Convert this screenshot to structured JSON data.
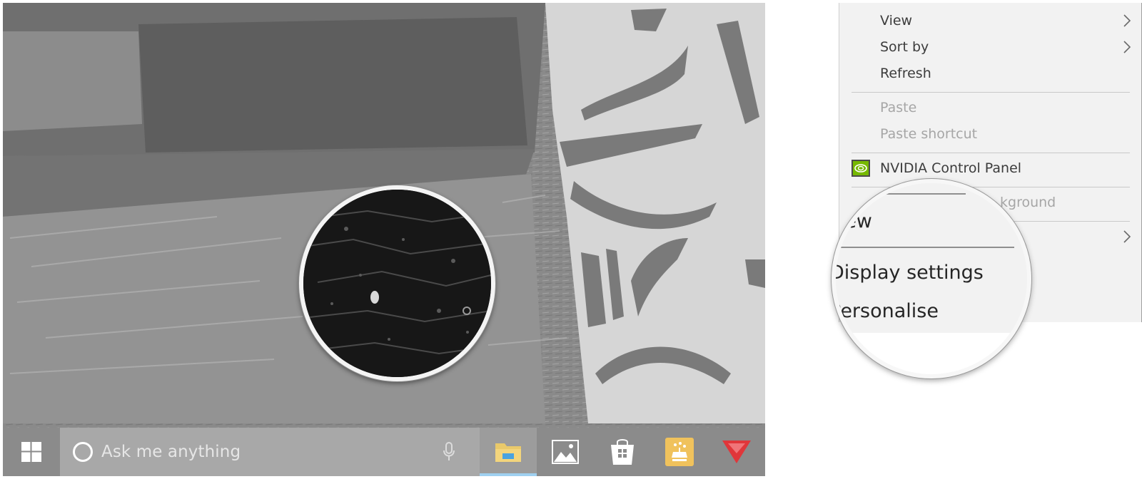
{
  "taskbar": {
    "search_placeholder": "Ask me anything",
    "icons": [
      "windows-start-icon",
      "cortana-icon",
      "microphone-icon",
      "file-explorer-icon",
      "photos-icon",
      "store-icon",
      "paint-icon",
      "app-red-icon"
    ],
    "active_indicator_color": "#9fd0f0"
  },
  "context_menu": {
    "items": [
      {
        "label": "View",
        "enabled": true,
        "submenu": true
      },
      {
        "label": "Sort by",
        "enabled": true,
        "submenu": true
      },
      {
        "label": "Refresh",
        "enabled": true,
        "submenu": false
      },
      {
        "label": "Paste",
        "enabled": false,
        "submenu": false
      },
      {
        "label": "Paste shortcut",
        "enabled": false,
        "submenu": false
      },
      {
        "label": "NVIDIA Control Panel",
        "enabled": true,
        "submenu": false,
        "icon": "nvidia-icon"
      },
      {
        "label": "kground",
        "enabled": false,
        "submenu": false
      }
    ],
    "nvidia_color": "#76b900"
  },
  "zoom_lens": {
    "items": [
      {
        "label": "New"
      },
      {
        "label": "Display settings"
      },
      {
        "label": "Personalise"
      }
    ]
  }
}
